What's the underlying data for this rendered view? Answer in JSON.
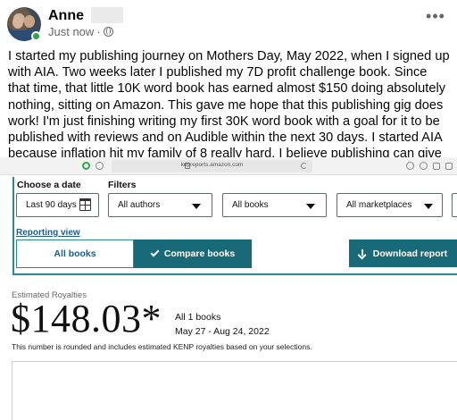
{
  "post": {
    "author_first_name": "Anne",
    "timestamp": "Just now",
    "audience_icon": "globe-icon",
    "more_icon": "more-options-icon",
    "body": "I started my publishing journey on Mothers Day, May 2022, when I signed up with AIA. Two weeks later I published my 7D profit challenge book. Since that time, that little 10K word book has earned almost $150 doing absolutely nothing, sitting on Amazon. This gave me hope that this publishing gig does work! I'm just finishing writing my first 30K word book with a goal for it to be published with reviews and on Audible within the next 30 days. I started AIA because inflation hit my family of 8 really hard. I believe publishing can give my family a brighter future."
  },
  "browser": {
    "url": "kdpreports.amazon.com"
  },
  "report": {
    "choose_date_label": "Choose a date",
    "date_value": "Last 90 days",
    "filters_label": "Filters",
    "authors_value": "All authors",
    "books_value": "All books",
    "marketplaces_value": "All marketplaces",
    "reporting_view_label": "Reporting view",
    "all_books_button": "All books",
    "compare_books_button": "Compare books",
    "download_button": "Download report",
    "royalties_label": "Estimated Royalties",
    "royalties_amount": "$148.03*",
    "books_count": "All 1 books",
    "date_range": "May 27 - Aug 24, 2022",
    "footnote": "This number is rounded and includes estimated KENP royalties based on your selections."
  },
  "colors": {
    "teal_primary": "#196a78",
    "teal_border": "#2b8a8a",
    "link_blue": "#1d5d8a",
    "online_green": "#31a24c"
  }
}
